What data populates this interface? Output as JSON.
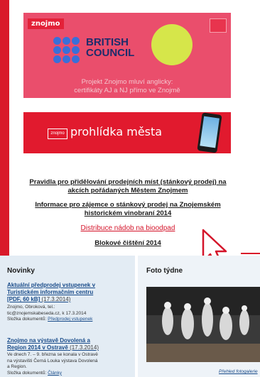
{
  "banners": {
    "first": {
      "logo": "znojmo",
      "council": [
        "BRITISH",
        "COUNCIL"
      ],
      "caption": [
        "Projekt Znojmo mluví anglicky:",
        "certifikáty AJ a NJ přímo ve Znojmě"
      ]
    },
    "second": {
      "logo_small": "znojmo",
      "title": "prohlídka města"
    }
  },
  "links": [
    {
      "lines": [
        "Pravidla pro přidělování prodejních míst (stánkový prodej) na",
        "akcích pořádaných Městem Znojmem"
      ]
    },
    {
      "lines": [
        "Informace pro zájemce o stánkový prodej na Znojemském",
        "historickém vinobraní 2014"
      ]
    },
    {
      "lines": [
        "Distribuce nádob na bioodpad"
      ]
    },
    {
      "lines": [
        "Blokové čištění 2014"
      ]
    }
  ],
  "news": {
    "heading": "Novinky",
    "items": [
      {
        "title": [
          "Aktuální předprodej vstupenek v",
          "Turistickém informačním centru",
          "[PDF, 60 kB]"
        ],
        "date": "(17.3.2014)",
        "text": [
          "Znojmo, Obroková, tel.:",
          "tic@znojemskabeseda.cz, k 17.3.2014"
        ],
        "section_label": "Složka dokumentů:",
        "section_link": "Předprodej vstupenek"
      },
      {
        "title": [
          "Znojmo na výstavě Dovolená a",
          "Region 2014 v Ostravě"
        ],
        "date": "(17.3.2014)",
        "text": [
          "Ve dnech 7. – 9. března se konala v Ostravě",
          "na výstavišti Černá Louka výstava Dovolená",
          "a Region."
        ],
        "section_label": "Složka dokumentů:",
        "section_link": "Články"
      }
    ]
  },
  "photo": {
    "heading": "Foto týdne",
    "link": "Přehled fotogalerie"
  },
  "colors": {
    "accent": "#d9192a",
    "link_blue": "#1a4c8a",
    "news_bg": "#e3ecf4"
  }
}
